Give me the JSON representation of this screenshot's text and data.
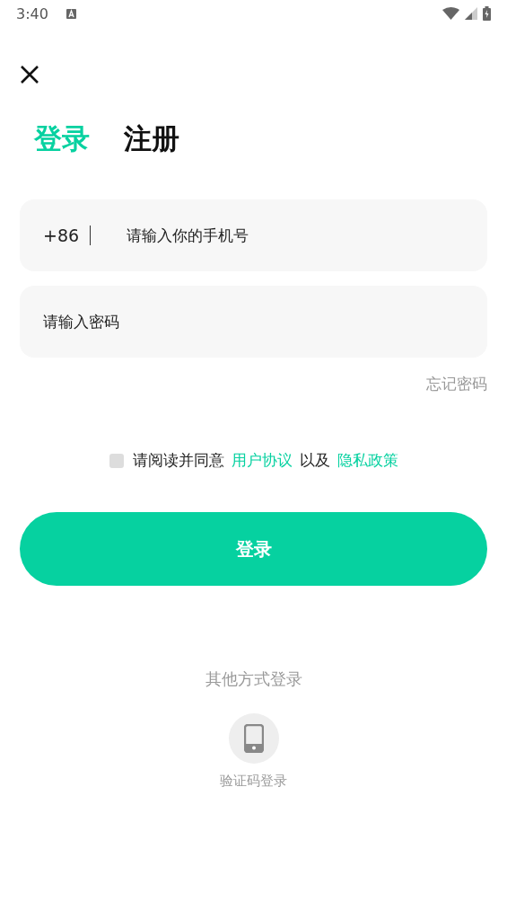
{
  "status_bar": {
    "time": "3:40"
  },
  "tabs": [
    {
      "label": "登录",
      "selected": true
    },
    {
      "label": "注册",
      "selected": false
    }
  ],
  "phone_field": {
    "prefix": "+86",
    "placeholder": "请输入你的手机号"
  },
  "password_field": {
    "placeholder": "请输入密码"
  },
  "forgot_password": "忘记密码",
  "agreement": {
    "checked": false,
    "parts": [
      {
        "kind": "text",
        "text": "请阅读并同意"
      },
      {
        "kind": "link",
        "text": "用户协议"
      },
      {
        "kind": "text",
        "text": "以及"
      },
      {
        "kind": "link",
        "text": "隐私政策"
      }
    ]
  },
  "login_button": "登录",
  "other_methods": {
    "title": "其他方式登录",
    "options": [
      {
        "label": "验证码登录"
      }
    ]
  }
}
